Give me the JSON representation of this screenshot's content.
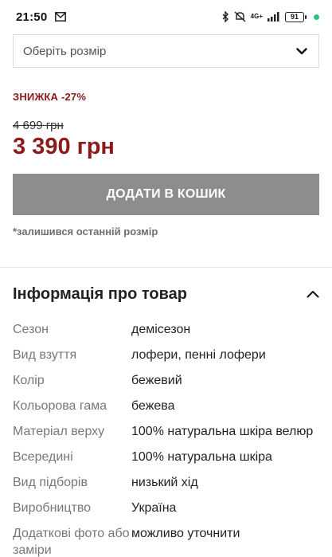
{
  "status_bar": {
    "time": "21:50",
    "network": "4G+",
    "battery": "91"
  },
  "size_select": {
    "placeholder": "Оберіть розмір"
  },
  "pricing": {
    "discount": "ЗНИЖКА -27%",
    "old_price": "4 699 грн",
    "new_price": "3 390 грн"
  },
  "cart": {
    "add_label": "ДОДАТИ В КОШИК",
    "last_size_note": "*залишився останній розмір"
  },
  "info": {
    "title": "Інформація про товар",
    "specs": [
      {
        "key": "Сезон",
        "value": "демісезон"
      },
      {
        "key": "Вид взуття",
        "value": "лофери, пенні лофери"
      },
      {
        "key": "Колір",
        "value": "бежевий"
      },
      {
        "key": "Кольорова гама",
        "value": "бежева"
      },
      {
        "key": "Матеріал верху",
        "value": "100% натуральна шкіра велюр"
      },
      {
        "key": "Всередині",
        "value": "100% натуральна шкіра"
      },
      {
        "key": "Вид підборів",
        "value": "низький хід"
      },
      {
        "key": "Виробництво",
        "value": "Україна"
      },
      {
        "key": "Додаткові фото або заміри",
        "value": "можливо уточнити"
      }
    ]
  },
  "colors": {
    "accent": "#8b1a1a",
    "button_bg": "#8d8d8d"
  }
}
